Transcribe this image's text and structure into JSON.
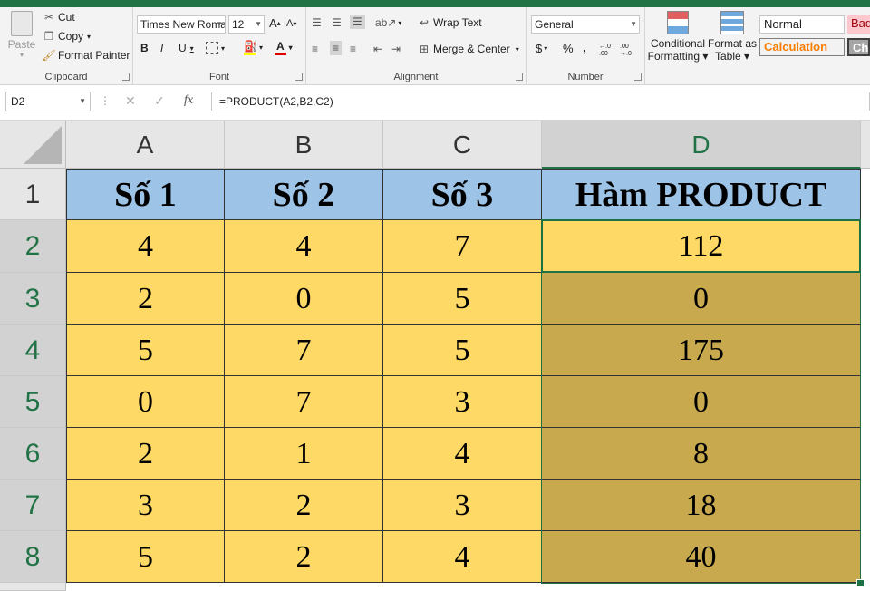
{
  "ribbon": {
    "clipboard": {
      "paste": "Paste",
      "cut": "Cut",
      "copy": "Copy",
      "format_painter": "Format Painter",
      "label": "Clipboard"
    },
    "font": {
      "name": "Times New Roma",
      "size": "12",
      "label": "Font",
      "bold": "B",
      "italic": "I",
      "underline": "U",
      "grow": "A",
      "shrink": "A",
      "font_color": "A"
    },
    "alignment": {
      "wrap_text": "Wrap Text",
      "merge_center": "Merge & Center",
      "label": "Alignment"
    },
    "number": {
      "format": "General",
      "currency": "$",
      "percent": "%",
      "comma": ",",
      "inc_decimal": "←.0 .00",
      "dec_decimal": ".00 →.0",
      "label": "Number"
    },
    "styles": {
      "conditional_formatting": [
        "Conditional",
        "Formatting"
      ],
      "format_as_table": [
        "Format as",
        "Table"
      ],
      "normal": "Normal",
      "bad": "Bad",
      "calculation": "Calculation",
      "check": "Che"
    }
  },
  "formula_bar": {
    "name_box": "D2",
    "fx": "fx",
    "formula": "=PRODUCT(A2,B2,C2)"
  },
  "sheet": {
    "columns": [
      "A",
      "B",
      "C",
      "D"
    ],
    "rows": [
      "1",
      "2",
      "3",
      "4",
      "5",
      "6",
      "7",
      "8"
    ],
    "header": [
      "Số 1",
      "Số 2",
      "Số 3",
      "Hàm PRODUCT"
    ],
    "data": [
      [
        "4",
        "4",
        "7",
        "112"
      ],
      [
        "2",
        "0",
        "5",
        "0"
      ],
      [
        "5",
        "7",
        "5",
        "175"
      ],
      [
        "0",
        "7",
        "3",
        "0"
      ],
      [
        "2",
        "1",
        "4",
        "8"
      ],
      [
        "3",
        "2",
        "3",
        "18"
      ],
      [
        "5",
        "2",
        "4",
        "40"
      ]
    ]
  },
  "colors": {
    "accent": "#217346",
    "header_fill": "#9dc3e6",
    "data_fill": "#ffd966",
    "result_fill": "#c9a94e"
  }
}
